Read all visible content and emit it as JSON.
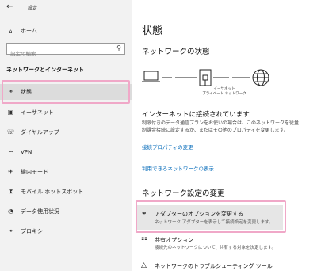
{
  "window": {
    "back_icon": "back-arrow-icon",
    "title": "設定"
  },
  "sidebar": {
    "home_label": "ホーム",
    "search_placeholder": "設定の検索",
    "section_title": "ネットワークとインターネット",
    "items": [
      {
        "label": "状態",
        "icon": "globe-icon",
        "active": true
      },
      {
        "label": "イーサネット",
        "icon": "ethernet-icon"
      },
      {
        "label": "ダイヤルアップ",
        "icon": "phone-icon"
      },
      {
        "label": "VPN",
        "icon": "vpn-icon"
      },
      {
        "label": "機内モード",
        "icon": "airplane-icon"
      },
      {
        "label": "モバイル ホットスポット",
        "icon": "hotspot-icon"
      },
      {
        "label": "データ使用状況",
        "icon": "data-usage-icon"
      },
      {
        "label": "プロキシ",
        "icon": "globe-icon"
      }
    ]
  },
  "main": {
    "title": "状態",
    "network_status_heading": "ネットワークの状態",
    "network_label_line1": "イーサネット",
    "network_label_line2": "プライベート ネットワーク",
    "connected_heading": "インターネットに接続されています",
    "connected_desc_line1": "制限付きのデータ通信プランをお使いの場合は、このネットワークを従量",
    "connected_desc_line2": "制課金接続に設定するか、またはその他のプロパティを変更します。",
    "link_properties": "接続プロパティの変更",
    "link_available": "利用できるネットワークの表示",
    "settings_heading": "ネットワーク設定の変更",
    "adapter_title": "アダプターのオプションを変更する",
    "adapter_desc": "ネットワーク アダプターを表示して接続設定を変更します。",
    "sharing_title": "共有オプション",
    "sharing_desc": "接続先のネットワークについて、共有する対象を決定します。",
    "troubleshoot_title": "ネットワークのトラブルシューティング ツール"
  }
}
